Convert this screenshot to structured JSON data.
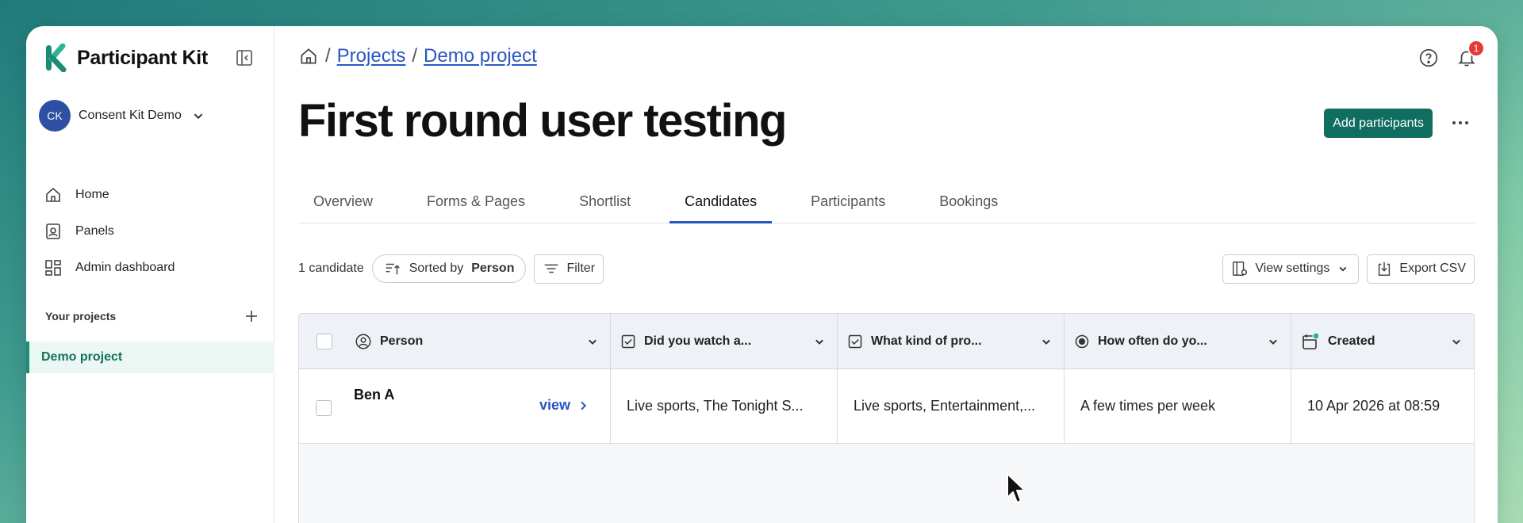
{
  "brand": {
    "name": "Participant Kit",
    "accent": "#1c8c74"
  },
  "account": {
    "initials": "CK",
    "name": "Consent Kit Demo"
  },
  "nav": [
    {
      "label": "Home",
      "icon": "home-icon"
    },
    {
      "label": "Panels",
      "icon": "panels-icon"
    },
    {
      "label": "Admin dashboard",
      "icon": "dashboard-icon"
    }
  ],
  "projects": {
    "title": "Your projects",
    "items": [
      {
        "label": "Demo project",
        "active": true
      }
    ]
  },
  "breadcrumb": {
    "projects": "Projects",
    "current": "Demo project",
    "sep": "/"
  },
  "notifications": {
    "count": "1"
  },
  "page": {
    "title": "First round user testing",
    "add_button": "Add participants"
  },
  "tabs": [
    {
      "label": "Overview"
    },
    {
      "label": "Forms & Pages"
    },
    {
      "label": "Shortlist"
    },
    {
      "label": "Candidates",
      "active": true
    },
    {
      "label": "Participants"
    },
    {
      "label": "Bookings"
    }
  ],
  "toolbar": {
    "count": "1 candidate",
    "sort_prefix": "Sorted by",
    "sort_field": "Person",
    "filter": "Filter",
    "view_settings": "View settings",
    "export": "Export CSV"
  },
  "table": {
    "headers": {
      "person": "Person",
      "q1": "Did you watch a...",
      "q2": "What kind of pro...",
      "q3": "How often do yo...",
      "created": "Created"
    },
    "rows": [
      {
        "person": "Ben A",
        "view": "view",
        "q1": "Live sports, The Tonight S...",
        "q2": "Live sports, Entertainment,...",
        "q3": "A few times per week",
        "created": "10 Apr 2026 at 08:59"
      }
    ]
  }
}
